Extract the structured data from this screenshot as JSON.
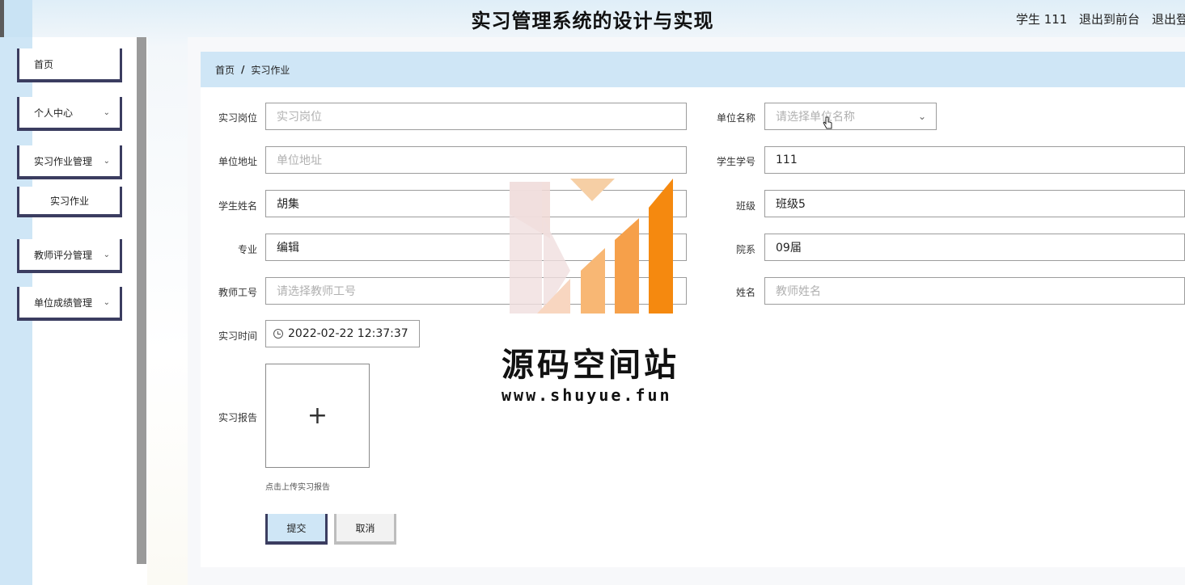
{
  "header": {
    "title": "实习管理系统的设计与实现",
    "user": "学生 111",
    "to_front": "退出到前台",
    "logout": "退出登"
  },
  "sidebar": {
    "items": [
      {
        "label": "首页"
      },
      {
        "label": "个人中心"
      },
      {
        "label": "实习作业管理"
      },
      {
        "label": "实习作业"
      },
      {
        "label": "教师评分管理"
      },
      {
        "label": "单位成绩管理"
      }
    ]
  },
  "breadcrumb": {
    "home": "首页",
    "sep": "/",
    "current": "实习作业"
  },
  "form": {
    "job": {
      "label": "实习岗位",
      "placeholder": "实习岗位"
    },
    "company": {
      "label": "单位名称",
      "placeholder": "请选择单位名称"
    },
    "address": {
      "label": "单位地址",
      "placeholder": "单位地址"
    },
    "student_no": {
      "label": "学生学号",
      "value": "111"
    },
    "student_name": {
      "label": "学生姓名",
      "value": "胡集"
    },
    "class": {
      "label": "班级",
      "value": "班级5"
    },
    "major": {
      "label": "专业",
      "value": "编辑"
    },
    "dept": {
      "label": "院系",
      "value": "09届"
    },
    "teacher_no": {
      "label": "教师工号",
      "placeholder": "请选择教师工号"
    },
    "teacher_name": {
      "label": "姓名",
      "placeholder": "教师姓名"
    },
    "time": {
      "label": "实习时间",
      "value": "2022-02-22 12:37:37"
    },
    "report": {
      "label": "实习报告",
      "tip": "点击上传实习报告"
    },
    "submit": "提交",
    "cancel": "取消"
  },
  "watermark": {
    "text": "源码空间站",
    "url": "www.shuyue.fun"
  },
  "colors": {
    "accent": "#cfe6f6",
    "border": "#3b3d60",
    "logo_orange": "#f5890f",
    "logo_pink": "#f0d9d6"
  }
}
